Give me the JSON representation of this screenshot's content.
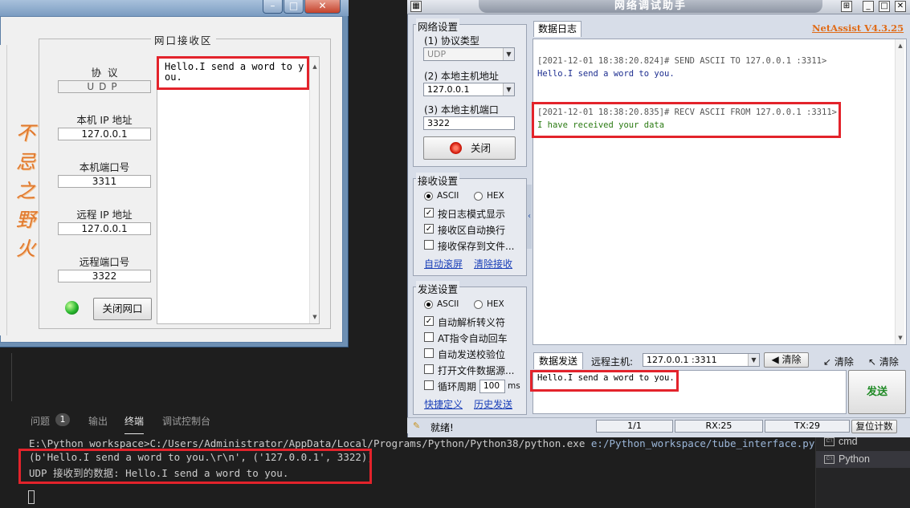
{
  "terminal": {
    "tabs": [
      {
        "label": "问题",
        "badge": "1"
      },
      {
        "label": "输出"
      },
      {
        "label": "终端"
      },
      {
        "label": "调试控制台"
      }
    ],
    "cmd_prefix": "E:\\Python workspace>C:/Users/Administrator/AppData/Local/Programs/Python/Python38/python.exe",
    "cmd_script": "e:/Python_workspace/tube_interface.py",
    "output_line1": "(b'Hello.I send a word to you.\\r\\n', ('127.0.0.1', 3322))",
    "output_line2": "UDP 接收到的数据: Hello.I send a word to you.",
    "side_items": [
      "cmd",
      "Python"
    ]
  },
  "left_app": {
    "group_title": "网口接收区",
    "protocol_label": "协  议",
    "protocol_value": "UDP",
    "local_ip_label": "本机 IP 地址",
    "local_ip": "127.0.0.1",
    "local_port_label": "本机端口号",
    "local_port": "3311",
    "remote_ip_label": "远程 IP 地址",
    "remote_ip": "127.0.0.1",
    "remote_port_label": "远程端口号",
    "remote_port": "3322",
    "close_button": "关闭网口",
    "calligraphy": [
      "不",
      "忌",
      "之",
      "野",
      "火"
    ],
    "received_text": "Hello.I send a word to you."
  },
  "netassist": {
    "title": "网络调试助手",
    "version": "NetAssist V4.3.25",
    "net_settings": {
      "title": "网络设置",
      "protocol_label": "(1) 协议类型",
      "protocol_value": "UDP",
      "host_ip_label": "(2) 本地主机地址",
      "host_ip": "127.0.0.1",
      "host_port_label": "(3) 本地主机端口",
      "host_port": "3322",
      "close_button": "关闭"
    },
    "recv_settings": {
      "title": "接收设置",
      "ascii": "ASCII",
      "hex": "HEX",
      "opt_log_mode": "按日志模式显示",
      "opt_auto_wrap": "接收区自动换行",
      "opt_save_file": "接收保存到文件...",
      "link_auto_scroll": "自动滚屏",
      "link_clear": "清除接收"
    },
    "send_settings": {
      "title": "发送设置",
      "ascii": "ASCII",
      "hex": "HEX",
      "opt_escape": "自动解析转义符",
      "opt_at_cr": "AT指令自动回车",
      "opt_checksum": "自动发送校验位",
      "opt_file_source": "打开文件数据源...",
      "opt_loop": "循环周期",
      "loop_value": "100",
      "loop_unit": "ms",
      "link_shortcut": "快捷定义",
      "link_history": "历史发送"
    },
    "log_tab": "数据日志",
    "log": [
      {
        "head": "[2021-12-01 18:38:20.824]# SEND ASCII TO 127.0.0.1 :3311>",
        "body": "Hello.I send a word to you.",
        "color": "#1c2d8f"
      },
      {
        "head": "[2021-12-01 18:38:20.835]# RECV ASCII FROM 127.0.0.1 :3311>",
        "body": "I have received your data",
        "color": "#2a7a12"
      }
    ],
    "send_bar": {
      "tab": "数据发送",
      "remote_label": "远程主机:",
      "remote_value": "127.0.0.1 :3311",
      "clear1": "清除",
      "clear2": "清除",
      "clear3": "清除"
    },
    "send_text": "Hello.I send a word to you.",
    "send_button": "发送",
    "status": {
      "ready": "就绪!",
      "count": "1/1",
      "rx": "RX:25",
      "tx": "TX:29",
      "reset": "复位计数"
    }
  }
}
